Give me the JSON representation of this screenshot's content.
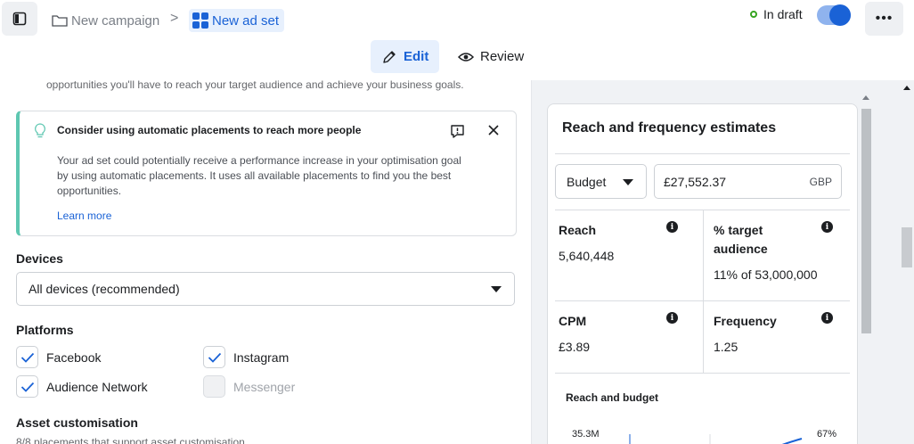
{
  "header": {
    "breadcrumb": {
      "campaign": "New campaign",
      "separator": ">",
      "ad_set": "New ad set"
    },
    "status": "In draft",
    "toggle_on": true,
    "more_label": "•••",
    "tabs": [
      {
        "label": "Edit",
        "active": true
      },
      {
        "label": "Review",
        "active": false
      }
    ]
  },
  "left": {
    "intro_text": "opportunities you'll have to reach your target audience and achieve your business goals.",
    "tip": {
      "title": "Consider using automatic placements to reach more people",
      "body": "Your ad set could potentially receive a performance increase in your optimisation goal by using automatic placements. It uses all available placements to find you the best opportunities.",
      "link": "Learn more"
    },
    "devices": {
      "label": "Devices",
      "selected": "All devices (recommended)"
    },
    "platforms": {
      "label": "Platforms",
      "items": [
        {
          "label": "Facebook",
          "checked": true,
          "disabled": false
        },
        {
          "label": "Instagram",
          "checked": true,
          "disabled": false
        },
        {
          "label": "Audience Network",
          "checked": true,
          "disabled": false
        },
        {
          "label": "Messenger",
          "checked": false,
          "disabled": true
        }
      ]
    },
    "asset": {
      "label": "Asset customisation",
      "sub": "8/8 placements that support asset customisation"
    }
  },
  "right": {
    "title": "Reach and frequency estimates",
    "budget_type": "Budget",
    "amount": "£27,552.37",
    "currency": "GBP",
    "metrics": {
      "reach": {
        "label": "Reach",
        "value": "5,640,448"
      },
      "target": {
        "label": "% target audience",
        "value": "11% of 53,000,000"
      },
      "cpm": {
        "label": "CPM",
        "value": "£3.89"
      },
      "frequency": {
        "label": "Frequency",
        "value": "1.25"
      }
    },
    "info_glyph": "i",
    "chart": {
      "title": "Reach and budget",
      "y_label": "35.3M",
      "pct_label": "67%"
    }
  },
  "colors": {
    "accent": "#1a62d6",
    "tip_border": "#5ec7b1",
    "status_green": "#36a420"
  }
}
